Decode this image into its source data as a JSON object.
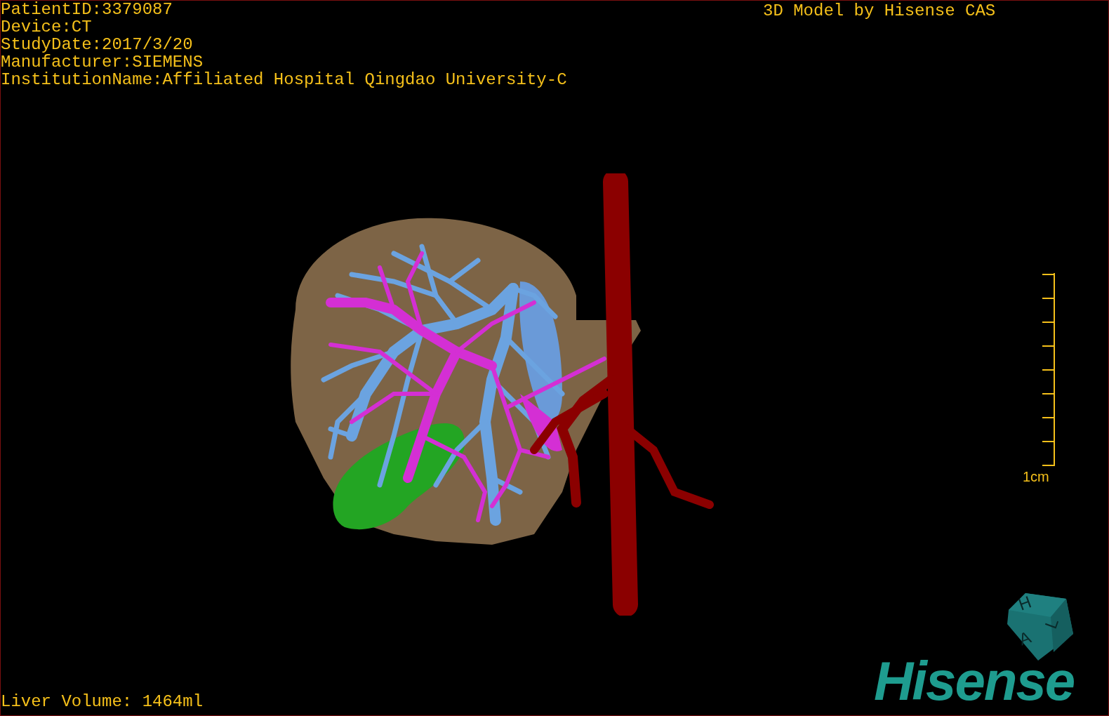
{
  "patient_info": [
    "PatientID:3379087",
    "Device:CT",
    "StudyDate:2017/3/20",
    "Manufacturer:SIEMENS",
    "InstitutionName:Affiliated Hospital Qingdao University-C"
  ],
  "header_right": "3D Model by Hisense CAS",
  "scale_bar": {
    "label": "1cm"
  },
  "orientation_cube": {
    "faces": [
      "H",
      "A",
      "L"
    ]
  },
  "logo": "Hisense",
  "liver_volume": "Liver Volume: 1464ml"
}
